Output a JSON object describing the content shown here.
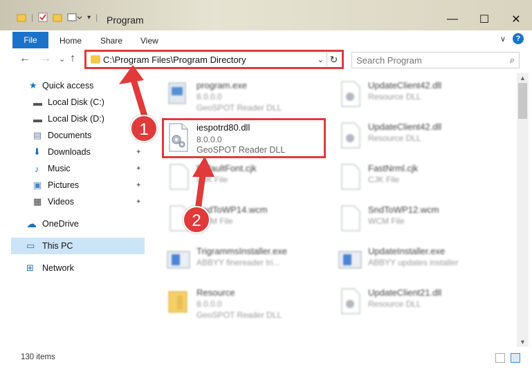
{
  "window": {
    "title": "Program",
    "minimize_glyph": "—",
    "maximize_glyph": "☐",
    "close_glyph": "✕"
  },
  "ribbon": {
    "tabs": [
      "File",
      "Home",
      "Share",
      "View"
    ],
    "help_glyph": "?",
    "collapse_glyph": "∨"
  },
  "address": {
    "path": "C:\\Program Files\\Program Directory",
    "dropdown_glyph": "⌄",
    "refresh_glyph": "↻"
  },
  "nav": {
    "back": "←",
    "forward": "→",
    "recent": "⌄",
    "up": "↑"
  },
  "search": {
    "placeholder": "Search Program",
    "icon": "search-icon"
  },
  "sidebar": {
    "items": [
      {
        "label": "Quick access",
        "icon": "star-icon",
        "glyph": "★"
      },
      {
        "label": "Local Disk (C:)",
        "icon": "drive-icon",
        "glyph": "▬"
      },
      {
        "label": "Local Disk (D:)",
        "icon": "drive-icon",
        "glyph": "▬"
      },
      {
        "label": "Documents",
        "icon": "documents-icon",
        "glyph": "▤",
        "pinned": true
      },
      {
        "label": "Downloads",
        "icon": "download-icon",
        "glyph": "⬇",
        "pinned": true
      },
      {
        "label": "Music",
        "icon": "music-icon",
        "glyph": "♪",
        "pinned": true
      },
      {
        "label": "Pictures",
        "icon": "pictures-icon",
        "glyph": "▣",
        "pinned": true
      },
      {
        "label": "Videos",
        "icon": "videos-icon",
        "glyph": "▦",
        "pinned": true
      },
      {
        "label": "OneDrive",
        "icon": "cloud-icon",
        "glyph": "☁"
      },
      {
        "label": "This PC",
        "icon": "computer-icon",
        "glyph": "▭",
        "selected": true
      },
      {
        "label": "Network",
        "icon": "network-icon",
        "glyph": "⊞"
      }
    ],
    "pin_glyph": "📌"
  },
  "files": {
    "left": [
      {
        "name": "program.exe",
        "version": "8.0.0.0",
        "desc": "GeoSPOT Reader DLL"
      },
      {
        "name": "iespotrd80.dll",
        "version": "8.0.0.0",
        "desc": "GeoSPOT Reader DLL"
      },
      {
        "name": "DefaultFont.cjk",
        "version": "CJK File",
        "desc": ""
      },
      {
        "name": "SndToWP14.wcm",
        "version": "WCM File",
        "desc": ""
      },
      {
        "name": "TrigrammsInstaller.exe",
        "version": "ABBYY finereader tri...",
        "desc": ""
      },
      {
        "name": "Resource",
        "version": "8.0.0.0",
        "desc": "GeoSPOT Reader DLL"
      }
    ],
    "right": [
      {
        "name": "UpdateClient42.dll",
        "version": "Resource DLL",
        "desc": ""
      },
      {
        "name": "UpdateClient42.dll",
        "version": "Resource DLL",
        "desc": ""
      },
      {
        "name": "FastNrml.cjk",
        "version": "CJK File",
        "desc": ""
      },
      {
        "name": "SndToWP12.wcm",
        "version": "WCM File",
        "desc": ""
      },
      {
        "name": "UpdateInstaller.exe",
        "version": "ABBYY updates installer",
        "desc": ""
      },
      {
        "name": "UpdateClient21.dll",
        "version": "Resource DLL",
        "desc": ""
      }
    ]
  },
  "annotations": {
    "badge1": "1",
    "badge2": "2"
  },
  "status": {
    "item_count": "130 items"
  },
  "colors": {
    "accent": "#1a73c8",
    "highlight": "#e03a3a",
    "selected": "#cce4f7",
    "folder": "#f5c84c"
  }
}
